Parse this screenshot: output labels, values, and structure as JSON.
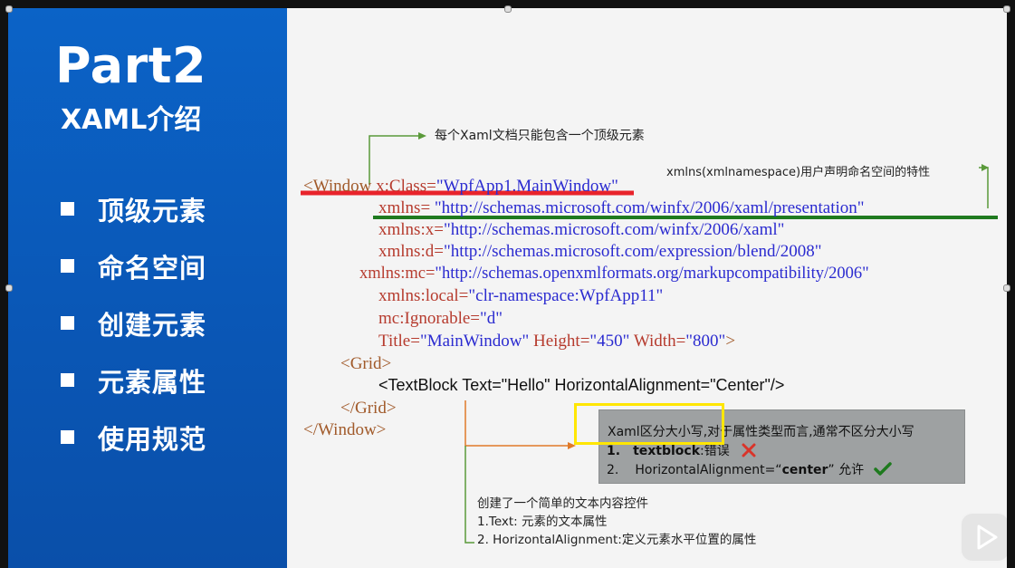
{
  "slide": {
    "part_title": "Part2",
    "subtitle": "XAML介绍",
    "menu": [
      {
        "label": "顶级元素"
      },
      {
        "label": "命名空间"
      },
      {
        "label": "创建元素"
      },
      {
        "label": "元素属性"
      },
      {
        "label": "使用规范"
      }
    ]
  },
  "annotations": {
    "top_level_note": "每个Xaml文档只能包含一个顶级元素",
    "xmlns_note": "xmlns(xmlnamespace)用户声明命名空间的特性",
    "textblock_note_title": "创建了一个简单的文本内容控件",
    "textblock_note_1": "1.Text: 元素的文本属性",
    "textblock_note_2": "2. HorizontalAlignment:定义元素水平位置的属性"
  },
  "tip": {
    "title": "Xaml区分大小写,对于属性类型而言,通常不区分大小写",
    "item1_num": "1.",
    "item1_bold": "textblock",
    "item1_rest": ":错误",
    "item2_num": "2.",
    "item2_pre": "HorizontalAlignment=“",
    "item2_bold": "center",
    "item2_rest": "” 允许"
  },
  "code": {
    "l1_tag": "<Window",
    "l1_attr": " x:Class=",
    "l1_val": "\"WpfApp1.MainWindow\"",
    "l2_attr": "xmlns=",
    "l2_val": "\"http://schemas.microsoft.com/winfx/2006/xaml/presentation\"",
    "l3_attr": "xmlns:x=",
    "l3_val": "\"http://schemas.microsoft.com/winfx/2006/xaml\"",
    "l4_attr": "xmlns:d=",
    "l4_val": "\"http://schemas.microsoft.com/expression/blend/2008\"",
    "l5_attr": "xmlns:mc=",
    "l5_val": "\"http://schemas.openxmlformats.org/markupcompatibility/2006\"",
    "l6_attr": "xmlns:local=",
    "l6_val": "\"clr-namespace:WpfApp11\"",
    "l7_attr": "mc:Ignorable=",
    "l7_val": "\"d\"",
    "l8_a1": "Title=",
    "l8_v1": "\"MainWindow\"",
    "l8_a2": " Height=",
    "l8_v2": "\"450\"",
    "l8_a3": " Width=",
    "l8_v3": "\"800\"",
    "l8_end": ">",
    "grid_open": "<Grid>",
    "textblock_line": "<TextBlock Text=\"Hello\" HorizontalAlignment=\"Center\"/>",
    "grid_close": "</Grid>",
    "window_close": "</Window>"
  },
  "colors": {
    "panel_blue": "#0b5fc2",
    "red_underline": "#e8232b",
    "green_underline": "#1f7a1f",
    "highlight_yellow": "#ffe600",
    "arrow_green": "#5a9a3a",
    "arrow_orange": "#e07a2a"
  },
  "icons": [
    "cross-icon",
    "check-icon",
    "play-icon"
  ]
}
